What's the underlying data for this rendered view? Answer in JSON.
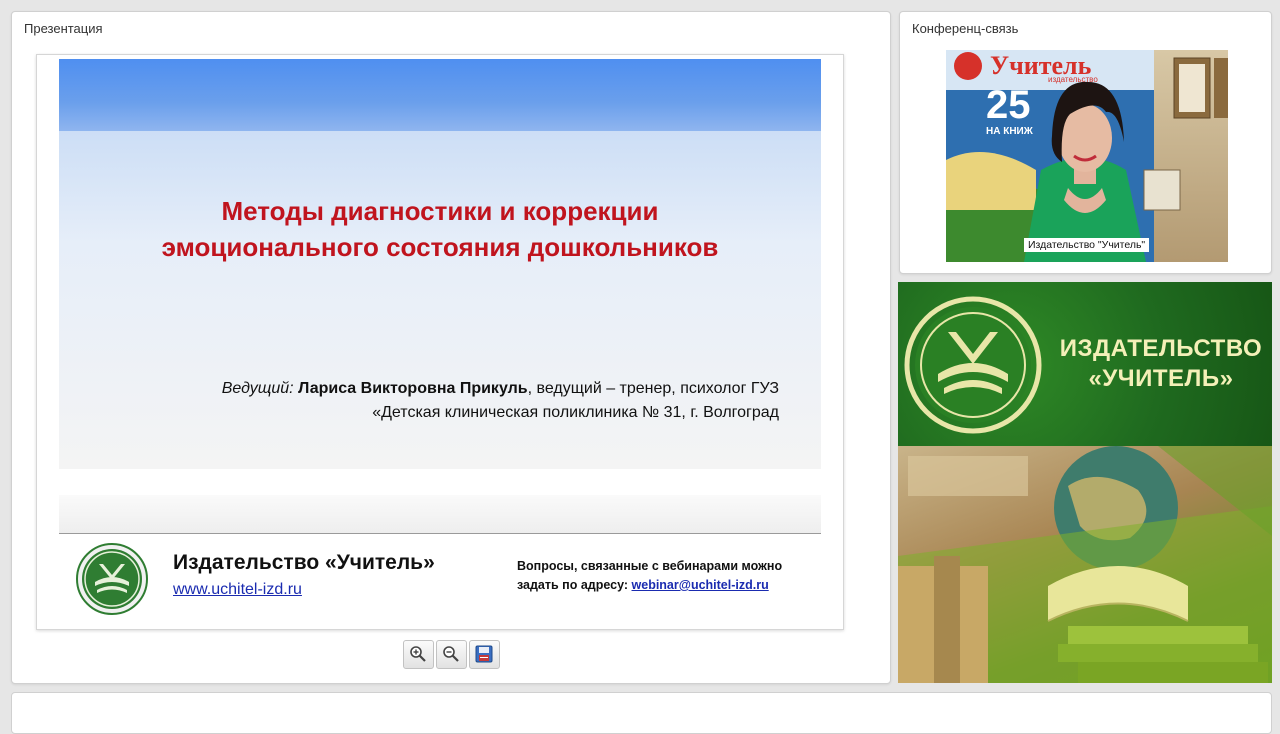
{
  "presentation_panel": {
    "title": "Презентация",
    "slide": {
      "title_line1": "Методы диагностики и коррекции",
      "title_line2": "эмоционального  состояния дошкольников",
      "presenter_role": "Ведущий:",
      "presenter_name": "Лариса Викторовна Прикуль",
      "presenter_desc": ", ведущий – тренер, психолог ГУЗ",
      "presenter_line2": "«Детская  клиническая поликлиника № 31, г.  Волгоград",
      "publisher_name": "Издательство «Учитель»",
      "publisher_url": "www.uchitel-izd.ru",
      "contact_line1": "Вопросы, связанные с вебинарами можно",
      "contact_line2_prefix": "задать по адресу: ",
      "contact_email": "webinar@uchitel-izd.ru"
    },
    "toolbar": [
      {
        "name": "zoom-in",
        "icon": "zoom-in-icon"
      },
      {
        "name": "zoom-out",
        "icon": "zoom-out-icon"
      },
      {
        "name": "save",
        "icon": "floppy-disk-icon"
      }
    ]
  },
  "conference_panel": {
    "title": "Конференц-связь",
    "video_label": "Издательство \"Учитель\"",
    "backdrop_text_1": "Учитель",
    "backdrop_text_2": "издательство",
    "backdrop_text_3": "25",
    "backdrop_text_4": "НА КНИЖ"
  },
  "banner": {
    "line1": "ИЗДАТЕЛЬСТВО",
    "line2": "«УЧИТЕЛЬ»"
  },
  "colors": {
    "slide_title": "#c0141e",
    "link": "#1a2bb0",
    "banner_green": "#1f6a1f",
    "banner_text": "#f4f0b8"
  }
}
